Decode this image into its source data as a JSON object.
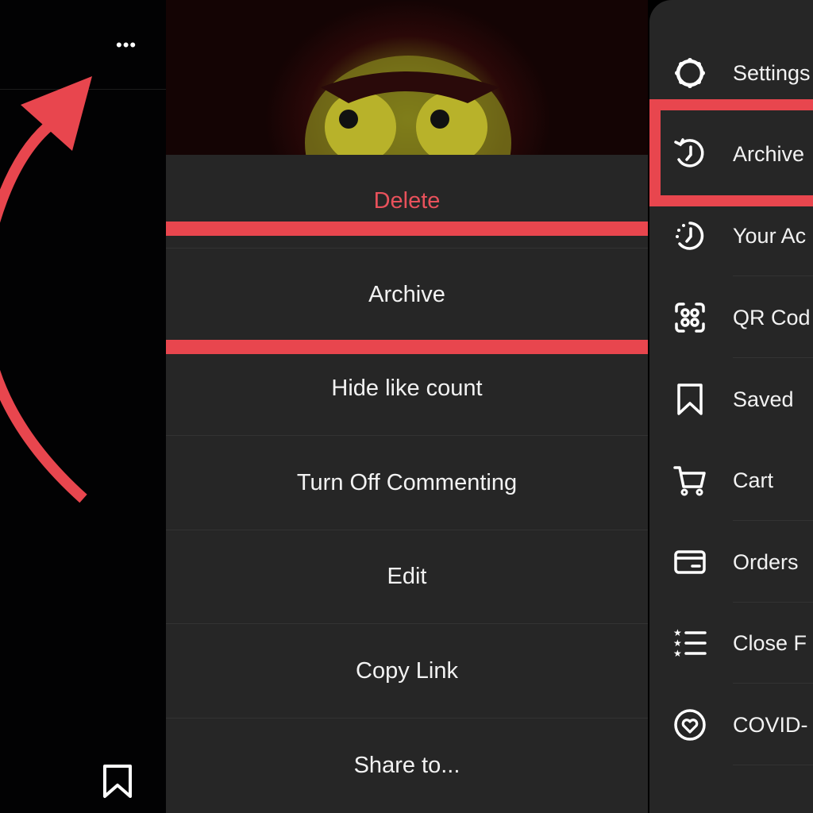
{
  "left": {
    "more_icon": "ellipsis-icon",
    "bookmark_icon": "bookmark-icon",
    "arrow_color": "#e8464e"
  },
  "sheet": {
    "items": [
      {
        "label": "Delete",
        "destructive": true
      },
      {
        "label": "Archive",
        "highlighted": true
      },
      {
        "label": "Hide like count"
      },
      {
        "label": "Turn Off Commenting"
      },
      {
        "label": "Edit"
      },
      {
        "label": "Copy Link"
      },
      {
        "label": "Share to..."
      }
    ],
    "delete_color": "#e8515b",
    "highlight_color": "#e8464e"
  },
  "menu": {
    "items": [
      {
        "label": "Settings",
        "icon": "gear-icon"
      },
      {
        "label": "Archive",
        "icon": "archive-clock-icon",
        "highlighted": true
      },
      {
        "label": "Your Ac",
        "icon": "activity-clock-icon"
      },
      {
        "label": "QR Cod",
        "icon": "qr-code-icon"
      },
      {
        "label": "Saved",
        "icon": "bookmark-icon"
      },
      {
        "label": "Cart",
        "icon": "cart-icon"
      },
      {
        "label": "Orders",
        "icon": "card-icon"
      },
      {
        "label": "Close F",
        "icon": "close-friends-list-icon"
      },
      {
        "label": "COVID-",
        "icon": "covid-heart-icon"
      }
    ]
  }
}
